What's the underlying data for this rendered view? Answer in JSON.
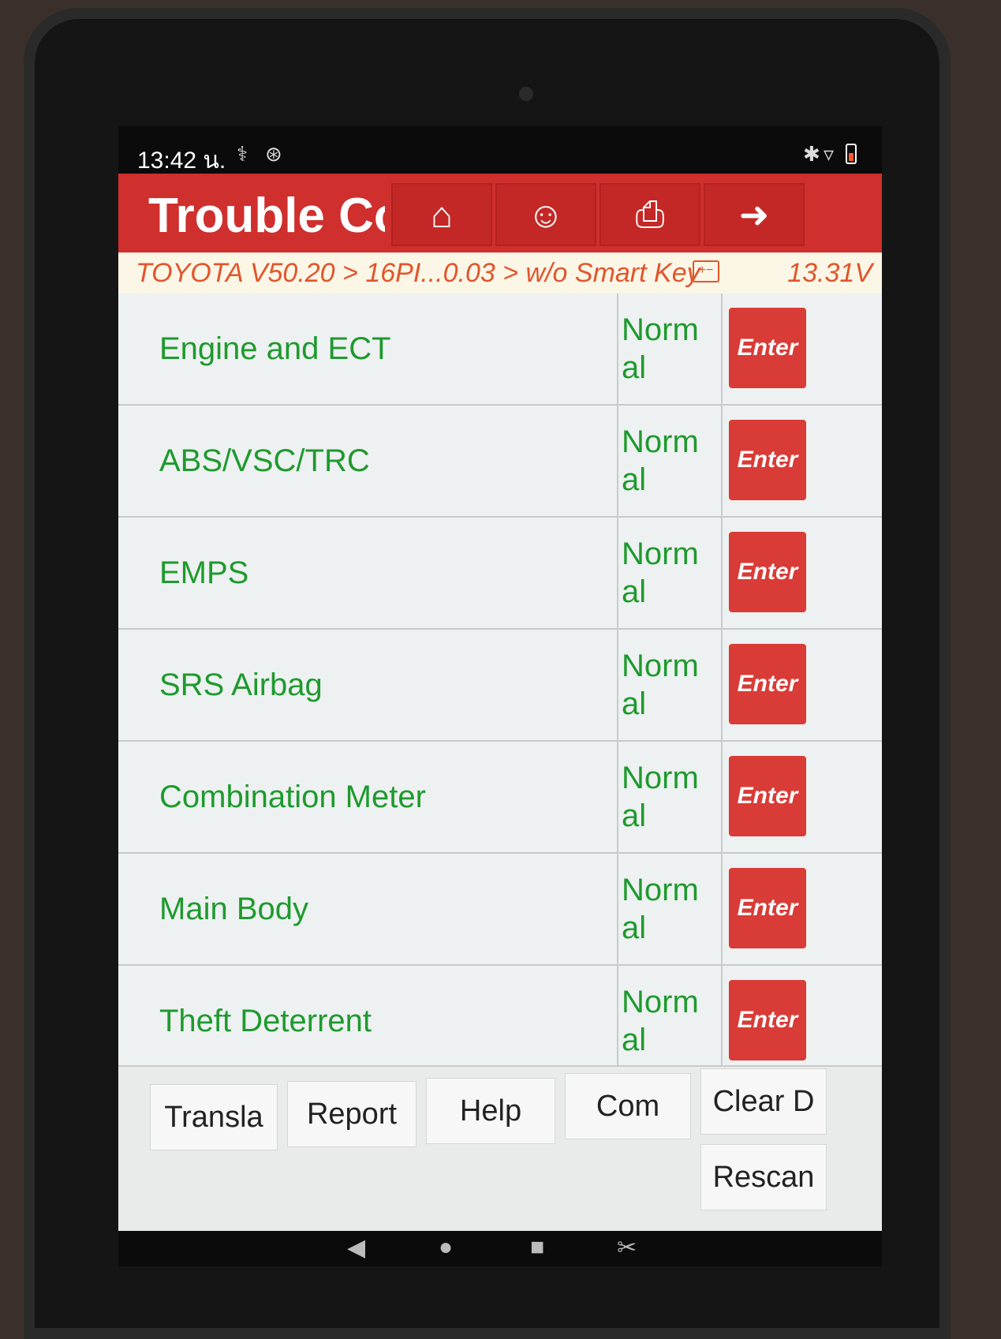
{
  "status_bar": {
    "time": "13:42 น.",
    "icons": [
      "stethoscope-icon",
      "accessibility-icon",
      "bluetooth-icon",
      "signal-icon",
      "battery-icon"
    ]
  },
  "title_bar": {
    "title": "Trouble Co",
    "buttons": [
      "home-icon",
      "support-agent-icon",
      "printer-icon",
      "exit-icon"
    ],
    "accent": "#cf2f2d"
  },
  "breadcrumb": {
    "path": "TOYOTA V50.20 > 16PI...0.03 > w/o Smart Key",
    "voltage": "13.31V"
  },
  "systems": [
    {
      "name": "Engine and ECT",
      "status": "Normal",
      "button": "Enter"
    },
    {
      "name": "ABS/VSC/TRC",
      "status": "Normal",
      "button": "Enter"
    },
    {
      "name": "EMPS",
      "status": "Normal",
      "button": "Enter"
    },
    {
      "name": "SRS Airbag",
      "status": "Normal",
      "button": "Enter"
    },
    {
      "name": "Combination Meter",
      "status": "Normal",
      "button": "Enter"
    },
    {
      "name": "Main Body",
      "status": "Normal",
      "button": "Enter"
    },
    {
      "name": "Theft Deterrent",
      "status": "Normal",
      "button": "Enter"
    }
  ],
  "actions": {
    "translate": "Transla",
    "report": "Report",
    "help": "Help",
    "compare": "Com",
    "clear": "Clear D",
    "rescan": "Rescan"
  },
  "colors": {
    "system_text": "#1e9a2e",
    "enter_button": "#d93b36",
    "breadcrumb_text": "#e2552b"
  }
}
